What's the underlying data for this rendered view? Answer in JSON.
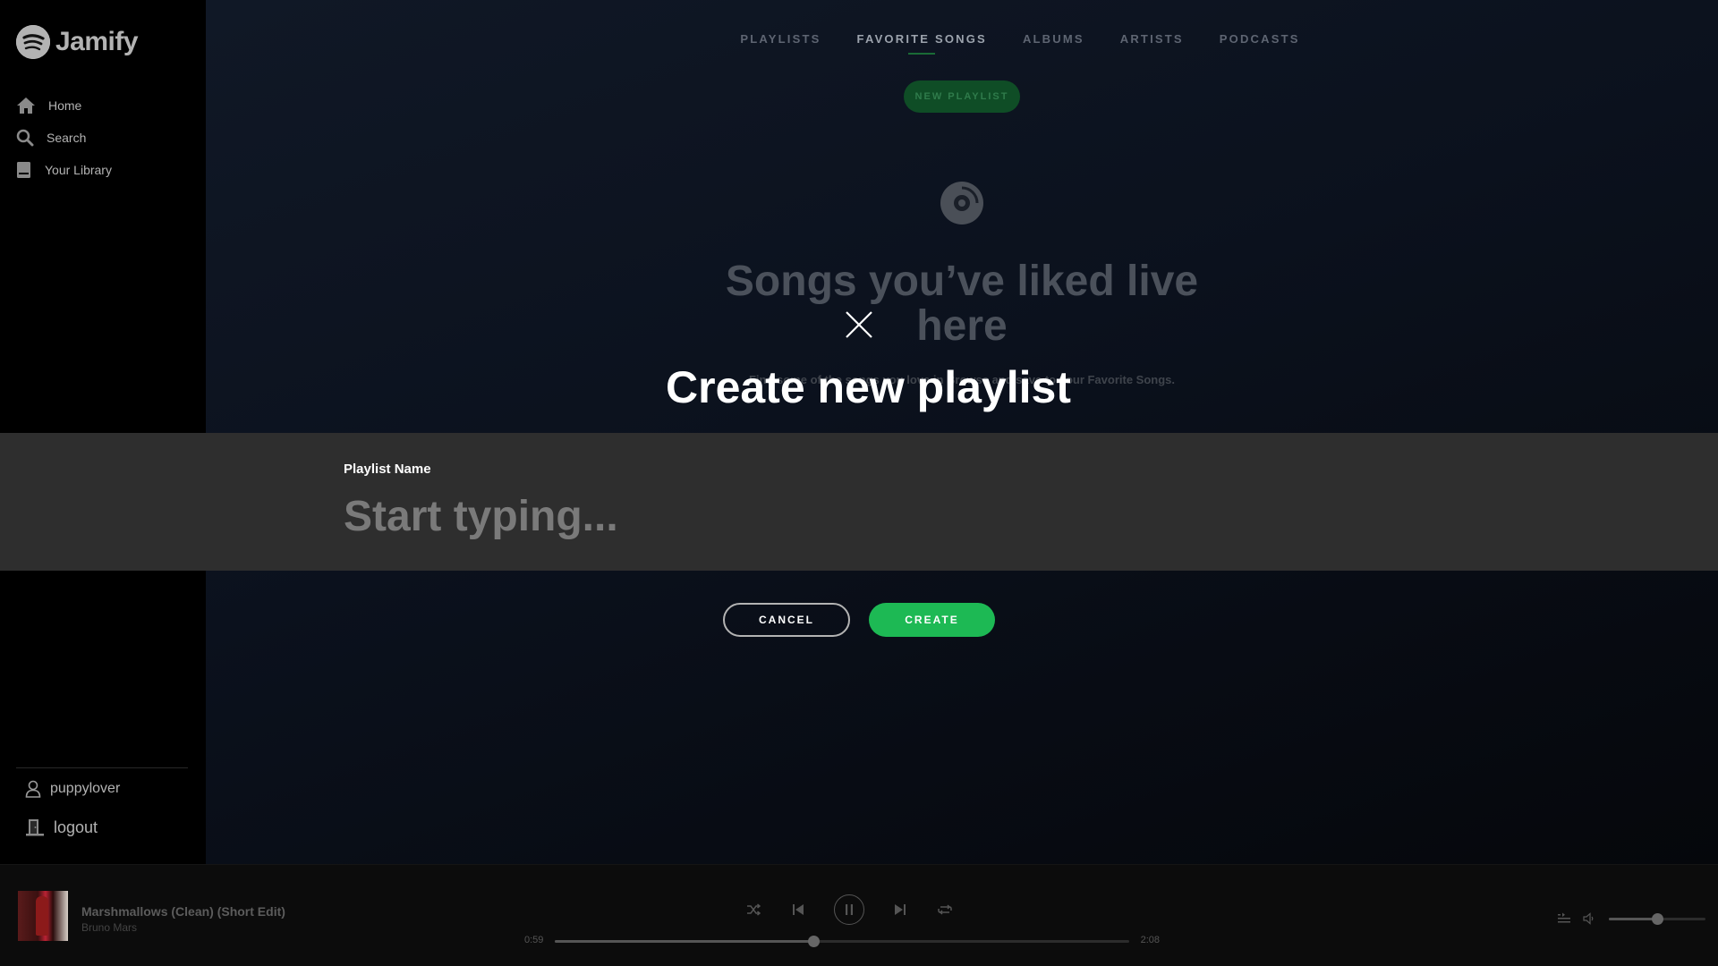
{
  "app": {
    "name": "Jamify"
  },
  "sidebar": {
    "items": [
      {
        "label": "Home",
        "icon": "home-icon"
      },
      {
        "label": "Search",
        "icon": "search-icon"
      },
      {
        "label": "Your Library",
        "icon": "library-icon"
      }
    ],
    "user": {
      "name": "puppylover",
      "icon": "user-icon"
    },
    "logout": {
      "label": "logout",
      "icon": "logout-icon"
    }
  },
  "main": {
    "tabs": [
      {
        "label": "PLAYLISTS",
        "active": false
      },
      {
        "label": "FAVORITE SONGS",
        "active": true
      },
      {
        "label": "ALBUMS",
        "active": false
      },
      {
        "label": "ARTISTS",
        "active": false
      },
      {
        "label": "PODCASTS",
        "active": false
      }
    ],
    "new_playlist_label": "NEW PLAYLIST",
    "empty_state": {
      "icon": "disc-icon",
      "title": "Songs you’ve liked live here",
      "subtitle": "Find some of the songs you love in Browse and save to your Favorite Songs."
    }
  },
  "modal": {
    "close_icon": "close-icon",
    "title": "Create new playlist",
    "field_label": "Playlist Name",
    "field_value": "",
    "field_placeholder": "Start typing...",
    "cancel_label": "CANCEL",
    "create_label": "CREATE"
  },
  "player": {
    "track_title": "Marshmallows (Clean) (Short Edit)",
    "artist": "Bruno Mars",
    "current_time": "0:59",
    "total_time": "2:08",
    "progress": 0.45,
    "volume": 0.5,
    "state": "playing"
  },
  "colors": {
    "accent": "#1db954",
    "background": "#000000",
    "modal_band": "#2e2e2e"
  }
}
